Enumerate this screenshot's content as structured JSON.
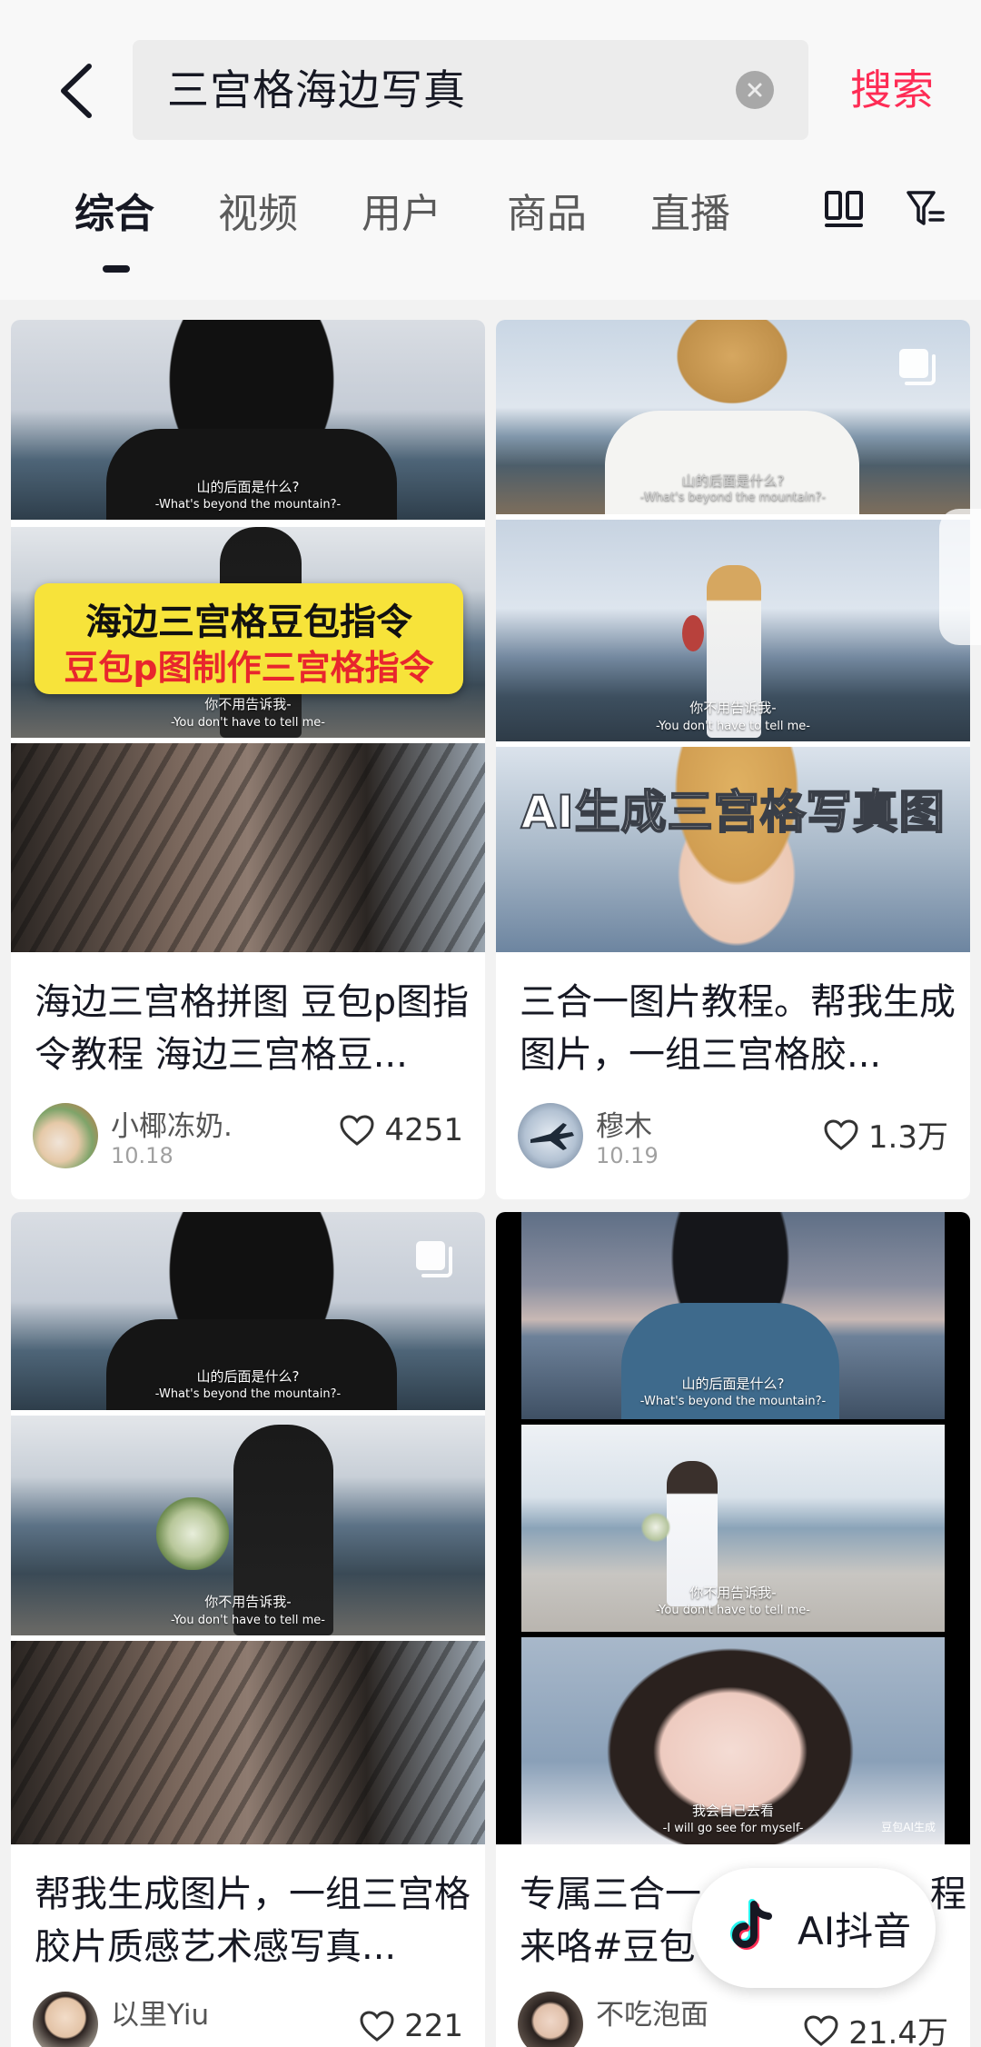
{
  "search": {
    "query": "三宫格海边写真",
    "button_label": "搜索"
  },
  "tabs": [
    {
      "label": "综合",
      "active": true
    },
    {
      "label": "视频",
      "active": false
    },
    {
      "label": "用户",
      "active": false
    },
    {
      "label": "商品",
      "active": false
    },
    {
      "label": "直播",
      "active": false
    }
  ],
  "icons": {
    "back": "chevron-left-icon",
    "clear": "clear-icon",
    "layout": "double-column-icon",
    "filter": "filter-icon",
    "like": "heart-icon",
    "multi_image": "multi-image-icon"
  },
  "colors": {
    "accent": "#fe2c55",
    "text": "#161823",
    "overlay_yellow": "#f7e33a",
    "overlay_red": "#e8262d"
  },
  "cards": [
    {
      "title": "海边三宫格拼图 豆包p图指令教程 海边三宫格豆...",
      "author": "小椰冻奶.",
      "date": "10.18",
      "likes": "4251",
      "overlay_line1": "海边三宫格豆包指令",
      "overlay_line2": "豆包p图制作三宫格指令",
      "sub1_cn": "山的后面是什么?",
      "sub1_en": "-What's beyond the mountain?-",
      "sub2_cn": "你不用告诉我-",
      "sub2_en": "-You don't have to tell me-"
    },
    {
      "title": "三合一图片教程。帮我生成图片，一组三宫格胶...",
      "author": "穆木",
      "date": "10.19",
      "likes": "1.3万",
      "overlay": "AI生成三宫格写真图",
      "sub1_cn": "山的后面是什么?",
      "sub1_en": "-What's beyond the mountain?-",
      "sub2_cn": "你不用告诉我-",
      "sub2_en": "-You don't have to tell me-"
    },
    {
      "title": "帮我生成图片，一组三宫格胶片质感艺术感写真...",
      "author": "以里Yiu",
      "likes": "221",
      "sub1_cn": "山的后面是什么?",
      "sub1_en": "-What's beyond the mountain?-",
      "sub2_cn": "你不用告诉我-",
      "sub2_en": "-You don't have to tell me-"
    },
    {
      "title": "专属三合一... 来咯#豆包...",
      "title_line1": "专属三合一",
      "title_line1_end": "程",
      "title_line2": "来咯#豆包",
      "author": "不吃泡面",
      "likes": "21.4万",
      "sub1_cn": "山的后面是什么?",
      "sub1_en": "-What's beyond the mountain?-",
      "sub2_cn": "你不用告诉我-",
      "sub2_en": "-You don't have to tell me-",
      "sub3_cn": "我会自己去看",
      "sub3_en": "-I will go see for myself-",
      "watermark": "豆包AI生成"
    }
  ],
  "ai_button": {
    "label": "AI抖音"
  }
}
